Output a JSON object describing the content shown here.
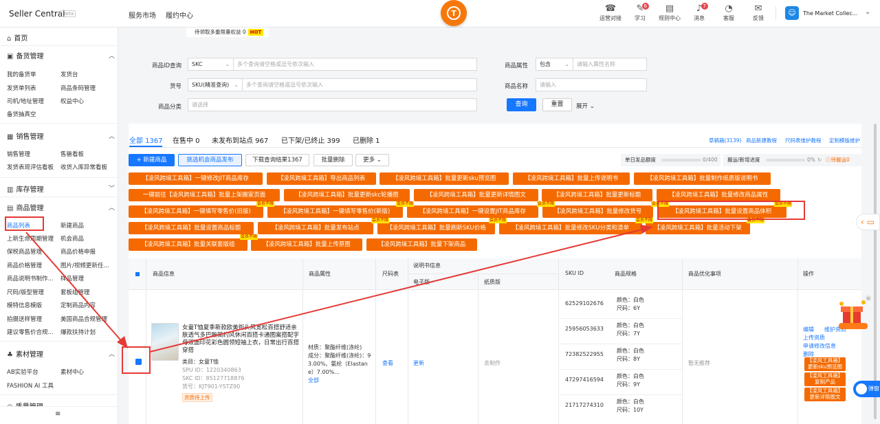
{
  "app": {
    "title": "Seller Central",
    "beta": "Beta"
  },
  "topnav": [
    "服务市场",
    "履约中心"
  ],
  "top_icons": [
    {
      "label": "运营对接",
      "icon": "chat-icon",
      "glyph": "☎",
      "badge": ""
    },
    {
      "label": "学习",
      "icon": "book-icon",
      "glyph": "✎",
      "badge": "6"
    },
    {
      "label": "规则中心",
      "icon": "document-icon",
      "glyph": "▤",
      "badge": ""
    },
    {
      "label": "消息",
      "icon": "bell-icon",
      "glyph": "♪",
      "badge": "7"
    },
    {
      "label": "客服",
      "icon": "headset-icon",
      "glyph": "◔",
      "badge": ""
    },
    {
      "label": "反馈",
      "icon": "feedback-icon",
      "glyph": "✉",
      "badge": ""
    }
  ],
  "shop": {
    "name": "The Market Collec...",
    "avatar": "☺"
  },
  "sidebar": {
    "home": "首页",
    "sections": [
      {
        "label": "备货管理",
        "items": [
          "我的备货单",
          "发货台",
          "发货单列表",
          "商品条码管理",
          "司机/地址管理",
          "权益中心",
          "备货抽真空"
        ]
      },
      {
        "label": "销售管理",
        "items": [
          "销售管理",
          "售罄看板",
          "发货表现评估看板",
          "收货入库异常看板"
        ]
      },
      {
        "label": "库存管理",
        "items": []
      },
      {
        "label": "商品管理",
        "items": [
          "商品列表",
          "新建商品",
          "上新生命周期管理",
          "机会商品",
          "保税商品管理",
          "商品价格申报",
          "商品价格管理",
          "图片/视频更新任...",
          "商品说明书制作...",
          "样品管理",
          "尺码/版型管理",
          "套板组管理",
          "模特信息模版",
          "定制商品内容",
          "拍摄送样管理",
          "美国商品合规管理",
          "建议零售价合规...",
          "爆款扶持计划"
        ]
      },
      {
        "label": "素材管理",
        "items": [
          "AB实验平台",
          "素材中心",
          "FASHION AI 工具"
        ]
      },
      {
        "label": "质量管理",
        "items": []
      }
    ],
    "collapse_icon": "≡"
  },
  "filters": {
    "hint": "待领取多重限量权益 0",
    "hot": "HOT",
    "id_label": "商品ID查询",
    "id_type": "SKC",
    "id_placeholder": "多个查询请空格或逗号依次输入",
    "code_label": "货号",
    "code_type": "SKU(精准查询)",
    "code_placeholder": "多个查询请空格或逗号依次输入",
    "cat_label": "商品分类",
    "cat_placeholder": "请选择",
    "attr_label": "商品属性",
    "attr_op": "包含",
    "attr_placeholder": "请输入属性名称",
    "name_label": "商品名称",
    "name_placeholder": "请输入",
    "search": "查询",
    "reset": "重置",
    "expand": "展开"
  },
  "tabs": [
    "全部 1367",
    "在售中 0",
    "未发布到站点 967",
    "已下架/已终止 399",
    "已删除 1"
  ],
  "right_links": [
    "草稿箱(3139)",
    "商品新建教程",
    "尺码表维护教程",
    "定制模版维护"
  ],
  "actions": {
    "new": "+ 新建商品",
    "pick": "挑选机会商品发布",
    "download": "下载查询结果1367",
    "bulk_delete": "批量删除",
    "more": "更多",
    "daily_limit_label": "单日发品额度",
    "daily_limit_value": "0/400",
    "daily_limit_fraction": 0,
    "migrate_label": "搬运/新增进度",
    "migrate_value": "0%",
    "migrate_fraction": 0,
    "pending": "待搬运0"
  },
  "orange_buttons": [
    [
      "【凌风跨境工具箱】一键修改JIT商品库存",
      "【凌风跨境工具箱】导出商品列表",
      "【凌风跨境工具箱】批量更新sku预览图",
      "【凌风跨境工具箱】批量上传说明书",
      "【凌风跨境工具箱】批量制作纸质版说明书"
    ],
    [
      "一键前往【凌风跨境工具箱】批量上架搬家页面",
      "【凌风跨境工具箱】批量更新skc轮播图",
      "【凌风跨境工具箱】批量更新详情图文",
      "【凌风跨境工具箱】批量更新标题",
      "【凌风跨境工具箱】批量修改商品属性"
    ],
    [
      "【凌风跨境工具箱】一键填写零售价(旧版)",
      "【凌风跨境工具箱】一键填写零售价(新版)",
      "【凌风跨境工具箱】一键设置JIT商品库存",
      "【凌风跨境工具箱】批量修改货号",
      "【凌风跨境工具箱】批量设置商品体积"
    ],
    [
      "【凌风跨境工具箱】批量设置商品标题",
      "【凌风跨境工具箱】批量发布站点",
      "【凌风跨境工具箱】批量刷新SKU价格",
      "【凌风跨境工具箱】批量修改SKU分类和清单",
      "【凌风跨境工具箱】批量活动下架"
    ],
    [
      "【凌风跨境工具箱】批量关联套版组",
      "【凌风跨境工具箱】批量上传原图",
      "【凌风跨境工具箱】批量下架商品"
    ]
  ],
  "member_tag": "会员不限",
  "table": {
    "headers": {
      "info": "商品信息",
      "attr": "商品属性",
      "size": "尺码表",
      "manual": "说明书信息",
      "manual_e": "电子版",
      "manual_p": "纸质版",
      "sku": "SKU ID",
      "spec": "商品规格",
      "opt": "商品优化事项",
      "ops": "操作"
    },
    "row": {
      "title": "女童T恤夏季新款欧美街头风宽松百搭舒适亲肤透气多巴胺简约风休闲百搭卡通图案搭配字母双面印花彩色圆领短袖上衣，日常出行百搭穿搭",
      "category": "类目：女童T恤",
      "spu": "SPU ID：1220340863",
      "skc": "SKC ID：85127718876",
      "code": "货号：KJT901-YSTZ90",
      "status_tag": "资质待上传",
      "attr_lines": [
        "材质：聚酯纤维(涤纶)",
        "成分：聚酯纤维(涤纶)：9",
        "3.00%、氨纶（Elastan",
        "e）7.00%..."
      ],
      "attr_all": "全部",
      "size_link": "查看",
      "manual_e": "更新",
      "manual_p": "去制作",
      "opt": "暂无推荐",
      "skus": [
        {
          "id": "62529102676",
          "color": "颜色：白色",
          "size": "尺码：6Y"
        },
        {
          "id": "25956053633",
          "color": "颜色：白色",
          "size": "尺码：7Y"
        },
        {
          "id": "72382522955",
          "color": "颜色：白色",
          "size": "尺码：8Y"
        },
        {
          "id": "47297416594",
          "color": "颜色：白色",
          "size": "尺码：9Y"
        },
        {
          "id": "21717274310",
          "color": "颜色：白色",
          "size": "尺码：10Y"
        }
      ],
      "ops": [
        "编辑",
        "维护资质",
        "上传资质",
        "申请修改信息",
        "删除"
      ],
      "ops_tags": [
        [
          "【凌风工具箱】",
          "更新sku预览图"
        ],
        [
          "【凌风工具箱】",
          "复制产品"
        ],
        [
          "【凌风工具箱】",
          "更新详情图文"
        ]
      ]
    }
  },
  "floating": {
    "feedback_icon": "chat-bubble-icon",
    "toggle": "弹窗"
  },
  "colors": {
    "accent": "#1677ff",
    "orange": "#f56a00",
    "annotation": "#e53935"
  }
}
